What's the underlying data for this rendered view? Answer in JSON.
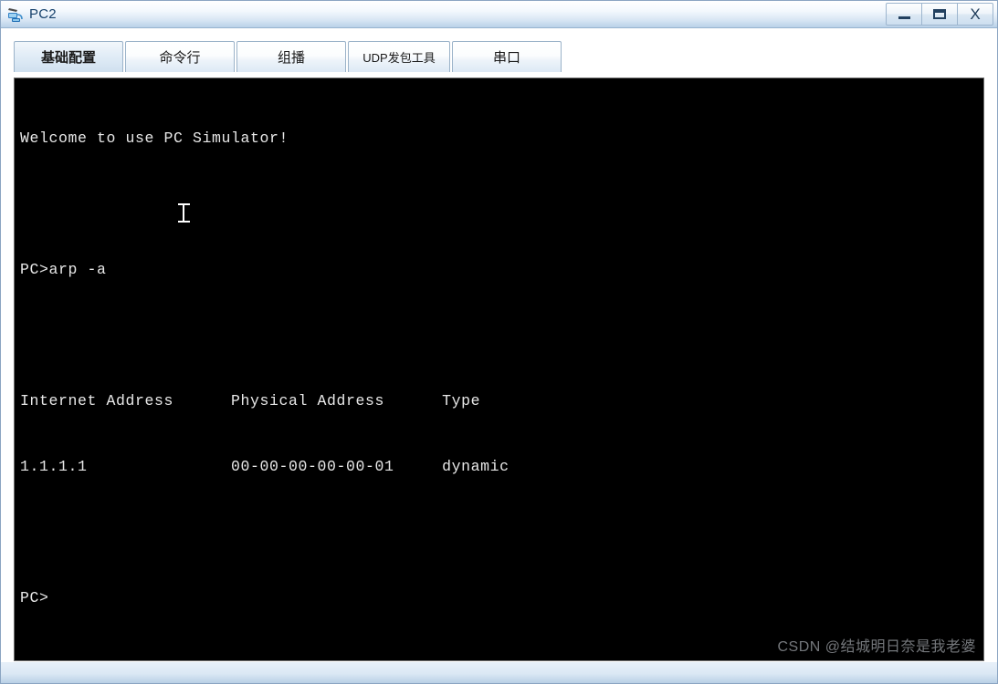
{
  "window": {
    "title": "PC2",
    "icon": "pc-device-icon",
    "controls": [
      {
        "name": "minimize",
        "label": "_"
      },
      {
        "name": "maximize",
        "label": "□"
      },
      {
        "name": "close",
        "label": "X"
      }
    ]
  },
  "tabs": [
    {
      "label": "基础配置",
      "active": true
    },
    {
      "label": "命令行",
      "active": false
    },
    {
      "label": "组播",
      "active": false
    },
    {
      "label": "UDP发包工具",
      "active": false
    },
    {
      "label": "串口",
      "active": false
    }
  ],
  "terminal": {
    "lines": [
      "Welcome to use PC Simulator!",
      "",
      "PC>arp -a",
      "",
      "Internet Address      Physical Address      Type",
      "1.1.1.1               00-00-00-00-00-01     dynamic",
      "",
      "PC>"
    ],
    "command": "arp -a",
    "prompt": "PC>",
    "arp_table": {
      "headers": [
        "Internet Address",
        "Physical Address",
        "Type"
      ],
      "rows": [
        [
          "1.1.1.1",
          "00-00-00-00-00-01",
          "dynamic"
        ]
      ]
    },
    "background_color": "#000000",
    "text_color": "#e8e8e8"
  },
  "watermark": {
    "text": "CSDN @结城明日奈是我老婆"
  },
  "theme": {
    "titlebar_accent": "#b9d1e8",
    "title_text": "#15406b",
    "tab_border": "#9bb3c9"
  }
}
